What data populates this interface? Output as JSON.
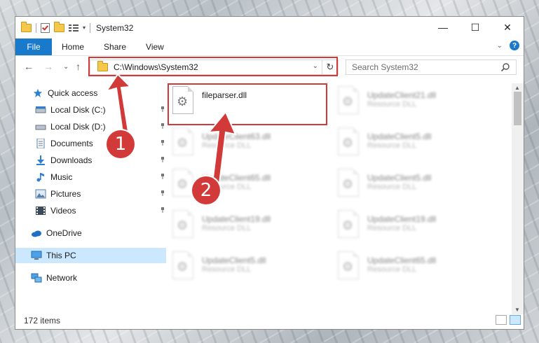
{
  "window": {
    "title": "System32",
    "controls": {
      "minimize": "—",
      "maximize": "☐",
      "close": "✕"
    }
  },
  "ribbon": {
    "tabs": [
      "File",
      "Home",
      "Share",
      "View"
    ],
    "help_label": "?",
    "collapse_label": "⌄"
  },
  "navigation": {
    "back": "←",
    "forward": "→",
    "recent": "⌄",
    "up": "↑",
    "address": "C:\\Windows\\System32",
    "address_dropdown": "⌄",
    "refresh": "↻",
    "search_placeholder": "Search System32"
  },
  "sidebar": {
    "quick_access": {
      "label": "Quick access",
      "items": [
        {
          "label": "Local Disk (C:)",
          "icon": "drive-icon"
        },
        {
          "label": "Local Disk (D:)",
          "icon": "drive-icon"
        },
        {
          "label": "Documents",
          "icon": "documents-icon"
        },
        {
          "label": "Downloads",
          "icon": "downloads-icon"
        },
        {
          "label": "Music",
          "icon": "music-icon"
        },
        {
          "label": "Pictures",
          "icon": "pictures-icon"
        },
        {
          "label": "Videos",
          "icon": "videos-icon"
        }
      ]
    },
    "onedrive": "OneDrive",
    "this_pc": "This PC",
    "network": "Network"
  },
  "files": {
    "highlighted": {
      "name": "fileparser.dll",
      "type": ""
    },
    "blurred": [
      {
        "name": "UpdateClient21.dll",
        "type": "Resource DLL"
      },
      {
        "name": "UpdateClient63.dll",
        "type": "Resource DLL"
      },
      {
        "name": "UpdateClient5.dll",
        "type": "Resource DLL"
      },
      {
        "name": "UpdateClient65.dll",
        "type": "Resource DLL"
      },
      {
        "name": "UpdateClient5.dll",
        "type": "Resource DLL"
      },
      {
        "name": "UpdateClient19.dll",
        "type": "Resource DLL"
      },
      {
        "name": "UpdateClient19.dll",
        "type": "Resource DLL"
      },
      {
        "name": "UpdateClient5.dll",
        "type": "Resource DLL"
      },
      {
        "name": "UpdateClient65.dll",
        "type": "Resource DLL"
      }
    ]
  },
  "status": {
    "item_count": "172 items"
  },
  "annotations": {
    "step1": "1",
    "step2": "2",
    "color": "#d23a3a"
  }
}
